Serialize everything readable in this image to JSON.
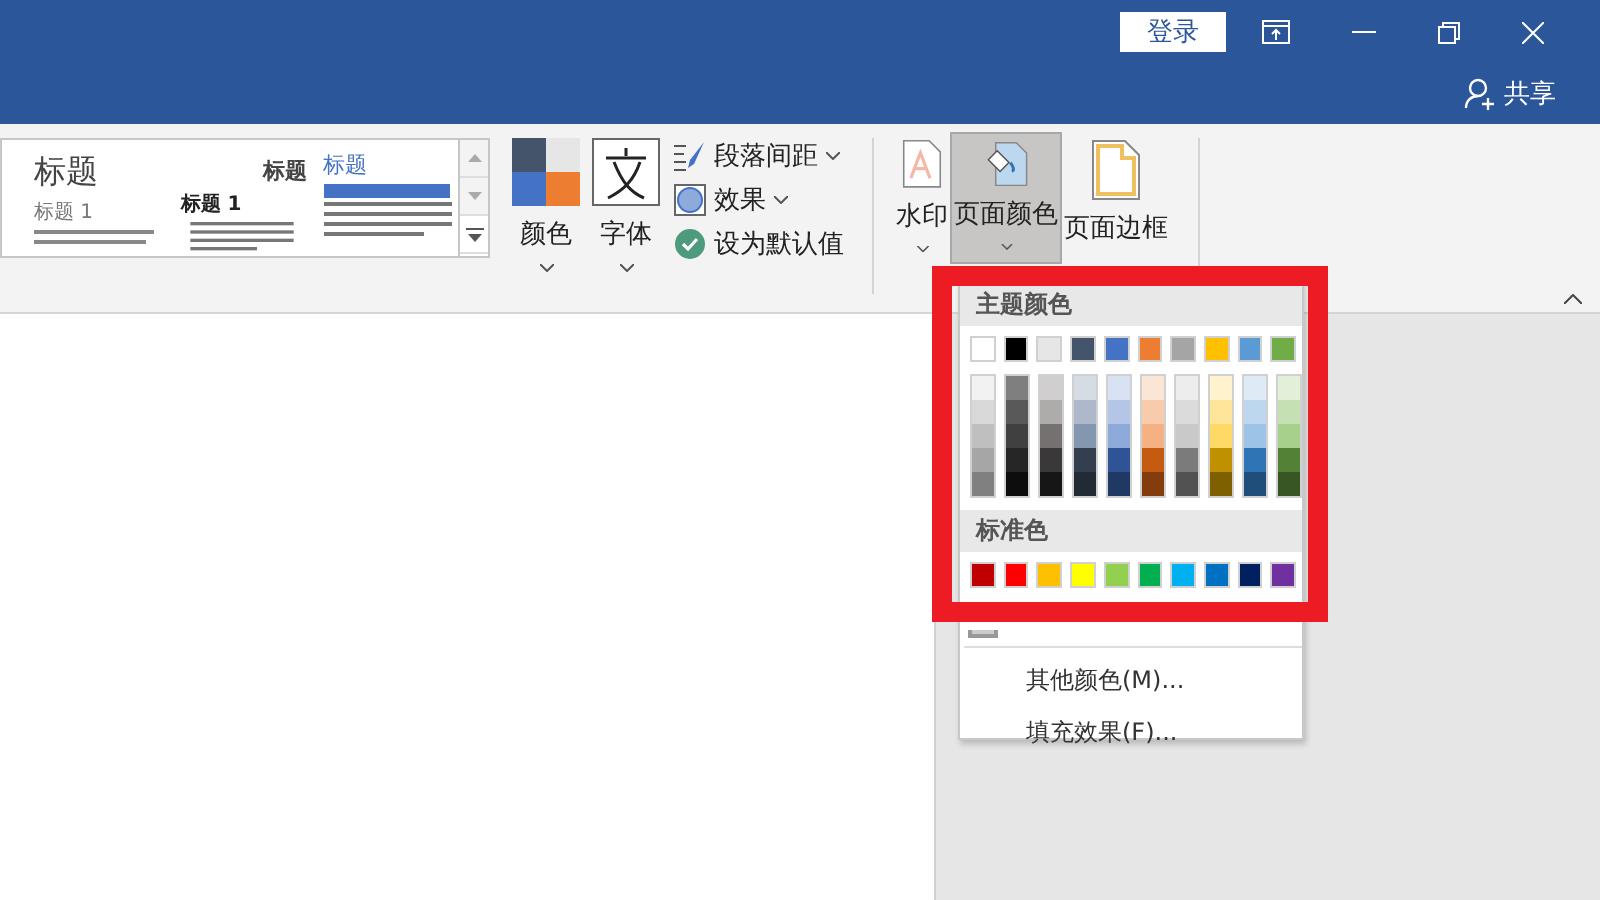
{
  "window": {
    "sign_in": "登录",
    "share": "共享"
  },
  "style_gallery": [
    {
      "kind": "plain",
      "title": "标题",
      "heading": "标题 1"
    },
    {
      "kind": "lined",
      "title": "标题",
      "heading": "标题 1"
    },
    {
      "kind": "banner",
      "title": "标题"
    }
  ],
  "design_buttons": [
    {
      "kind": "colors",
      "label": "颜色"
    },
    {
      "kind": "fonts",
      "label": "字体"
    }
  ],
  "design_options": [
    {
      "kind": "spacing",
      "label": "段落间距",
      "dropdown": true
    },
    {
      "kind": "effects",
      "label": "效果",
      "dropdown": true
    },
    {
      "kind": "default",
      "label": "设为默认值",
      "dropdown": false
    }
  ],
  "page_background": [
    {
      "kind": "watermark",
      "label": "水印",
      "selected": false,
      "dropdown": true
    },
    {
      "kind": "page-color",
      "label": "页面颜色",
      "selected": true,
      "dropdown": true
    },
    {
      "kind": "borders",
      "label": "页面边框",
      "selected": false,
      "dropdown": false
    }
  ],
  "color_menu": {
    "theme_header": "主题颜色",
    "theme_colors": [
      {
        "color": "#ffffff",
        "shades": [
          {
            "color": "#f2f2f2"
          },
          {
            "color": "#d9d9d9"
          },
          {
            "color": "#bfbfbf"
          },
          {
            "color": "#a6a6a6"
          },
          {
            "color": "#808080"
          }
        ]
      },
      {
        "color": "#000000",
        "shades": [
          {
            "color": "#7f7f7f"
          },
          {
            "color": "#595959"
          },
          {
            "color": "#404040"
          },
          {
            "color": "#262626"
          },
          {
            "color": "#0d0d0d"
          }
        ]
      },
      {
        "color": "#e7e6e6",
        "shades": [
          {
            "color": "#d0cece"
          },
          {
            "color": "#aeabab"
          },
          {
            "color": "#757171"
          },
          {
            "color": "#3a3838"
          },
          {
            "color": "#171616"
          }
        ]
      },
      {
        "color": "#44546a",
        "shades": [
          {
            "color": "#d6dce4"
          },
          {
            "color": "#adb9ca"
          },
          {
            "color": "#8497b0"
          },
          {
            "color": "#333f4f"
          },
          {
            "color": "#222a35"
          }
        ]
      },
      {
        "color": "#4472c4",
        "shades": [
          {
            "color": "#d9e2f3"
          },
          {
            "color": "#b4c6e7"
          },
          {
            "color": "#8eaadb"
          },
          {
            "color": "#2f5496"
          },
          {
            "color": "#1f3864"
          }
        ]
      },
      {
        "color": "#ed7d31",
        "shades": [
          {
            "color": "#fbe5d5"
          },
          {
            "color": "#f7cbac"
          },
          {
            "color": "#f4b183"
          },
          {
            "color": "#c55a11"
          },
          {
            "color": "#833c0b"
          }
        ]
      },
      {
        "color": "#a5a5a5",
        "shades": [
          {
            "color": "#ededed"
          },
          {
            "color": "#dbdbdb"
          },
          {
            "color": "#c9c9c9"
          },
          {
            "color": "#7b7b7b"
          },
          {
            "color": "#525252"
          }
        ]
      },
      {
        "color": "#ffc000",
        "shades": [
          {
            "color": "#fff2cc"
          },
          {
            "color": "#fee599"
          },
          {
            "color": "#ffd965"
          },
          {
            "color": "#bf9000"
          },
          {
            "color": "#7f6000"
          }
        ]
      },
      {
        "color": "#5b9bd5",
        "shades": [
          {
            "color": "#deebf6"
          },
          {
            "color": "#bdd7ee"
          },
          {
            "color": "#9dc3e6"
          },
          {
            "color": "#2e75b5"
          },
          {
            "color": "#1e4e79"
          }
        ]
      },
      {
        "color": "#70ad47",
        "shades": [
          {
            "color": "#e2efd9"
          },
          {
            "color": "#c5e0b3"
          },
          {
            "color": "#a8d08d"
          },
          {
            "color": "#538135"
          },
          {
            "color": "#375623"
          }
        ]
      }
    ],
    "standard_header": "标准色",
    "standard_colors": [
      {
        "color": "#c00000"
      },
      {
        "color": "#ff0000"
      },
      {
        "color": "#ffc000"
      },
      {
        "color": "#ffff00"
      },
      {
        "color": "#92d050"
      },
      {
        "color": "#00b050"
      },
      {
        "color": "#00b0f0"
      },
      {
        "color": "#0070c0"
      },
      {
        "color": "#002060"
      },
      {
        "color": "#7030a0"
      }
    ],
    "items": [
      "其他颜色(M)...",
      "填充效果(F)..."
    ]
  },
  "highlight_frame": true
}
